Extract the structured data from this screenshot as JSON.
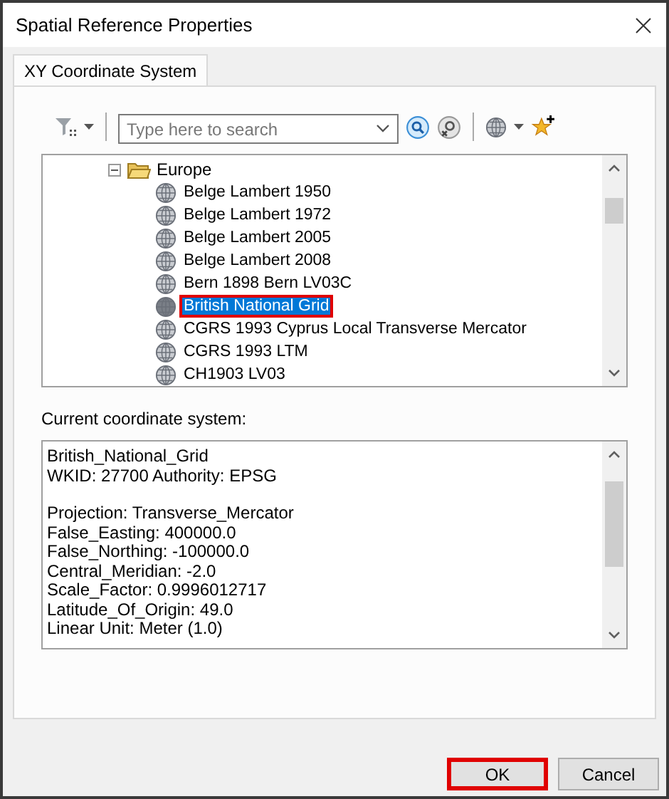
{
  "window": {
    "title": "Spatial Reference Properties"
  },
  "tabs": [
    {
      "label": "XY Coordinate System",
      "selected": true
    }
  ],
  "search": {
    "placeholder": "Type here to search"
  },
  "tree": [
    {
      "label": "Europe",
      "kind": "folder",
      "expanded": true,
      "children": [
        {
          "label": "Belge Lambert 1950",
          "kind": "crs",
          "selected": false,
          "highlighted": false
        },
        {
          "label": "Belge Lambert 1972",
          "kind": "crs",
          "selected": false,
          "highlighted": false
        },
        {
          "label": "Belge Lambert 2005",
          "kind": "crs",
          "selected": false,
          "highlighted": false
        },
        {
          "label": "Belge Lambert 2008",
          "kind": "crs",
          "selected": false,
          "highlighted": false
        },
        {
          "label": "Bern 1898 Bern LV03C",
          "kind": "crs",
          "selected": false,
          "highlighted": false
        },
        {
          "label": "British National Grid",
          "kind": "crs",
          "selected": true,
          "highlighted": true
        },
        {
          "label": "CGRS 1993 Cyprus Local Transverse Mercator",
          "kind": "crs",
          "selected": false,
          "highlighted": false
        },
        {
          "label": "CGRS 1993 LTM",
          "kind": "crs",
          "selected": false,
          "highlighted": false
        },
        {
          "label": "CH1903 LV03",
          "kind": "crs",
          "selected": false,
          "highlighted": false
        }
      ]
    }
  ],
  "current": {
    "label": "Current coordinate system:",
    "paragraphs": [
      [
        "British_National_Grid",
        "WKID: 27700 Authority: EPSG"
      ],
      [
        "Projection: Transverse_Mercator",
        "False_Easting: 400000.0",
        "False_Northing: -100000.0",
        "Central_Meridian: -2.0",
        "Scale_Factor: 0.9996012717",
        "Latitude_Of_Origin: 49.0",
        "Linear Unit: Meter (1.0)"
      ]
    ]
  },
  "buttons": [
    {
      "label": "OK",
      "highlighted": true
    },
    {
      "label": "Cancel",
      "highlighted": false
    }
  ]
}
